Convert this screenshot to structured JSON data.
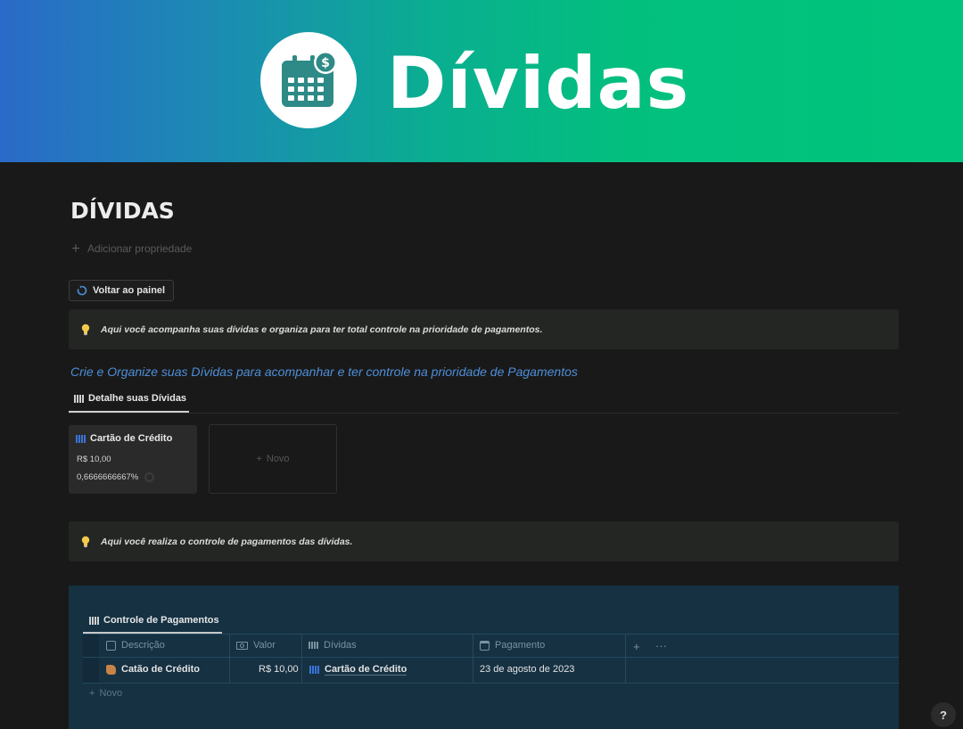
{
  "banner": {
    "title": "Dívidas",
    "icon": "calendar-dollar-icon",
    "gradient": [
      "#2a6ac8",
      "#00c47c"
    ]
  },
  "page": {
    "title": "DÍVIDAS",
    "add_property": "Adicionar propriedade"
  },
  "back_button": {
    "label": "Voltar ao painel",
    "icon": "refresh-icon"
  },
  "callout1": {
    "icon": "lightbulb-icon",
    "text": "Aqui você acompanha suas dívidas e organiza para ter total controle na prioridade de pagamentos."
  },
  "subtitle": "Crie e Organize suas Dívidas para acompanhar e ter controle na prioridade de Pagamentos",
  "gallery": {
    "tab_label": "Detalhe suas Dívidas",
    "cards": [
      {
        "title": "Cartão de Crédito",
        "value": "R$ 10,00",
        "percent": "0,6666666667%"
      }
    ],
    "new_label": "Novo"
  },
  "callout2": {
    "icon": "lightbulb-icon",
    "text": "Aqui você realiza o controle de pagamentos das dívidas."
  },
  "payments": {
    "tab_label": "Controle de Pagamentos",
    "columns": [
      "Descrição",
      "Valor",
      "Dívidas",
      "Pagamento"
    ],
    "rows": [
      {
        "descricao": "Catão de Crédito",
        "valor": "R$ 10,00",
        "dividas": "Cartão de Crédito",
        "pagamento": "23 de agosto de 2023"
      }
    ],
    "add_column": "+",
    "more": "···",
    "new_label": "Novo"
  },
  "help": "?",
  "colors": {
    "accent_blue": "#4d8fd9",
    "table_bg": "#153142",
    "callout_bg": "#232623"
  }
}
